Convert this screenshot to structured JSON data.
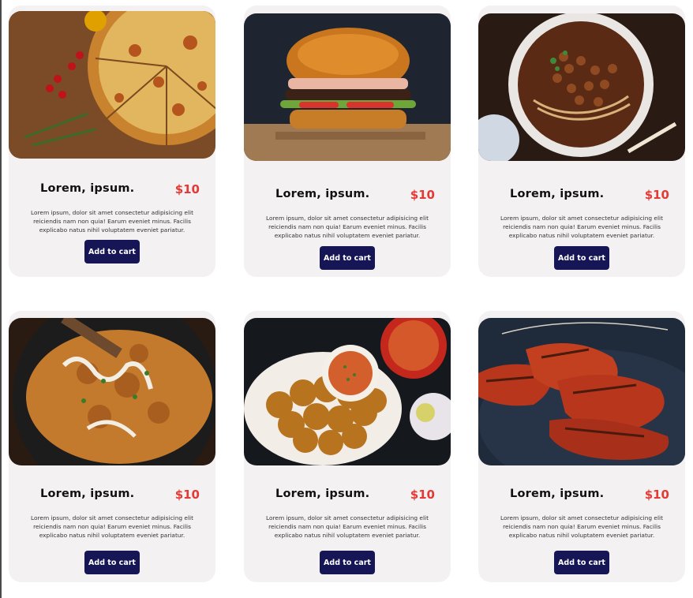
{
  "cards": [
    {
      "title": "Lorem, ipsum.",
      "price": "$10",
      "desc": "Lorem ipsum, dolor sit amet consectetur adipisicing elit reiciendis nam non quia! Earum eveniet minus. Facilis explicabo natus nihil voluptatem eveniet pariatur.",
      "button": "Add to cart",
      "image": "pizza"
    },
    {
      "title": "Lorem, ipsum.",
      "price": "$10",
      "desc": "Lorem ipsum, dolor sit amet consectetur adipisicing elit reiciendis nam non quia! Earum eveniet minus. Facilis explicabo natus nihil voluptatem eveniet pariatur.",
      "button": "Add to cart",
      "image": "burger"
    },
    {
      "title": "Lorem, ipsum.",
      "price": "$10",
      "desc": "Lorem ipsum, dolor sit amet consectetur adipisicing elit reiciendis nam non quia! Earum eveniet minus. Facilis explicabo natus nihil voluptatem eveniet pariatur.",
      "button": "Add to cart",
      "image": "noodle-soup"
    },
    {
      "title": "Lorem, ipsum.",
      "price": "$10",
      "desc": "Lorem ipsum, dolor sit amet consectetur adipisicing elit reiciendis nam non quia! Earum eveniet minus. Facilis explicabo natus nihil voluptatem eveniet pariatur.",
      "button": "Add to cart",
      "image": "curry"
    },
    {
      "title": "Lorem, ipsum.",
      "price": "$10",
      "desc": "Lorem ipsum, dolor sit amet consectetur adipisicing elit reiciendis nam non quia! Earum eveniet minus. Facilis explicabo natus nihil voluptatem eveniet pariatur.",
      "button": "Add to cart",
      "image": "pav-bhaji"
    },
    {
      "title": "Lorem, ipsum.",
      "price": "$10",
      "desc": "Lorem ipsum, dolor sit amet consectetur adipisicing elit reiciendis nam non quia! Earum eveniet minus. Facilis explicabo natus nihil voluptatem eveniet pariatur.",
      "button": "Add to cart",
      "image": "tandoori-chicken"
    }
  ],
  "colors": {
    "accent": "#161656",
    "price": "#e53935",
    "card_bg": "#f3f1f1"
  }
}
